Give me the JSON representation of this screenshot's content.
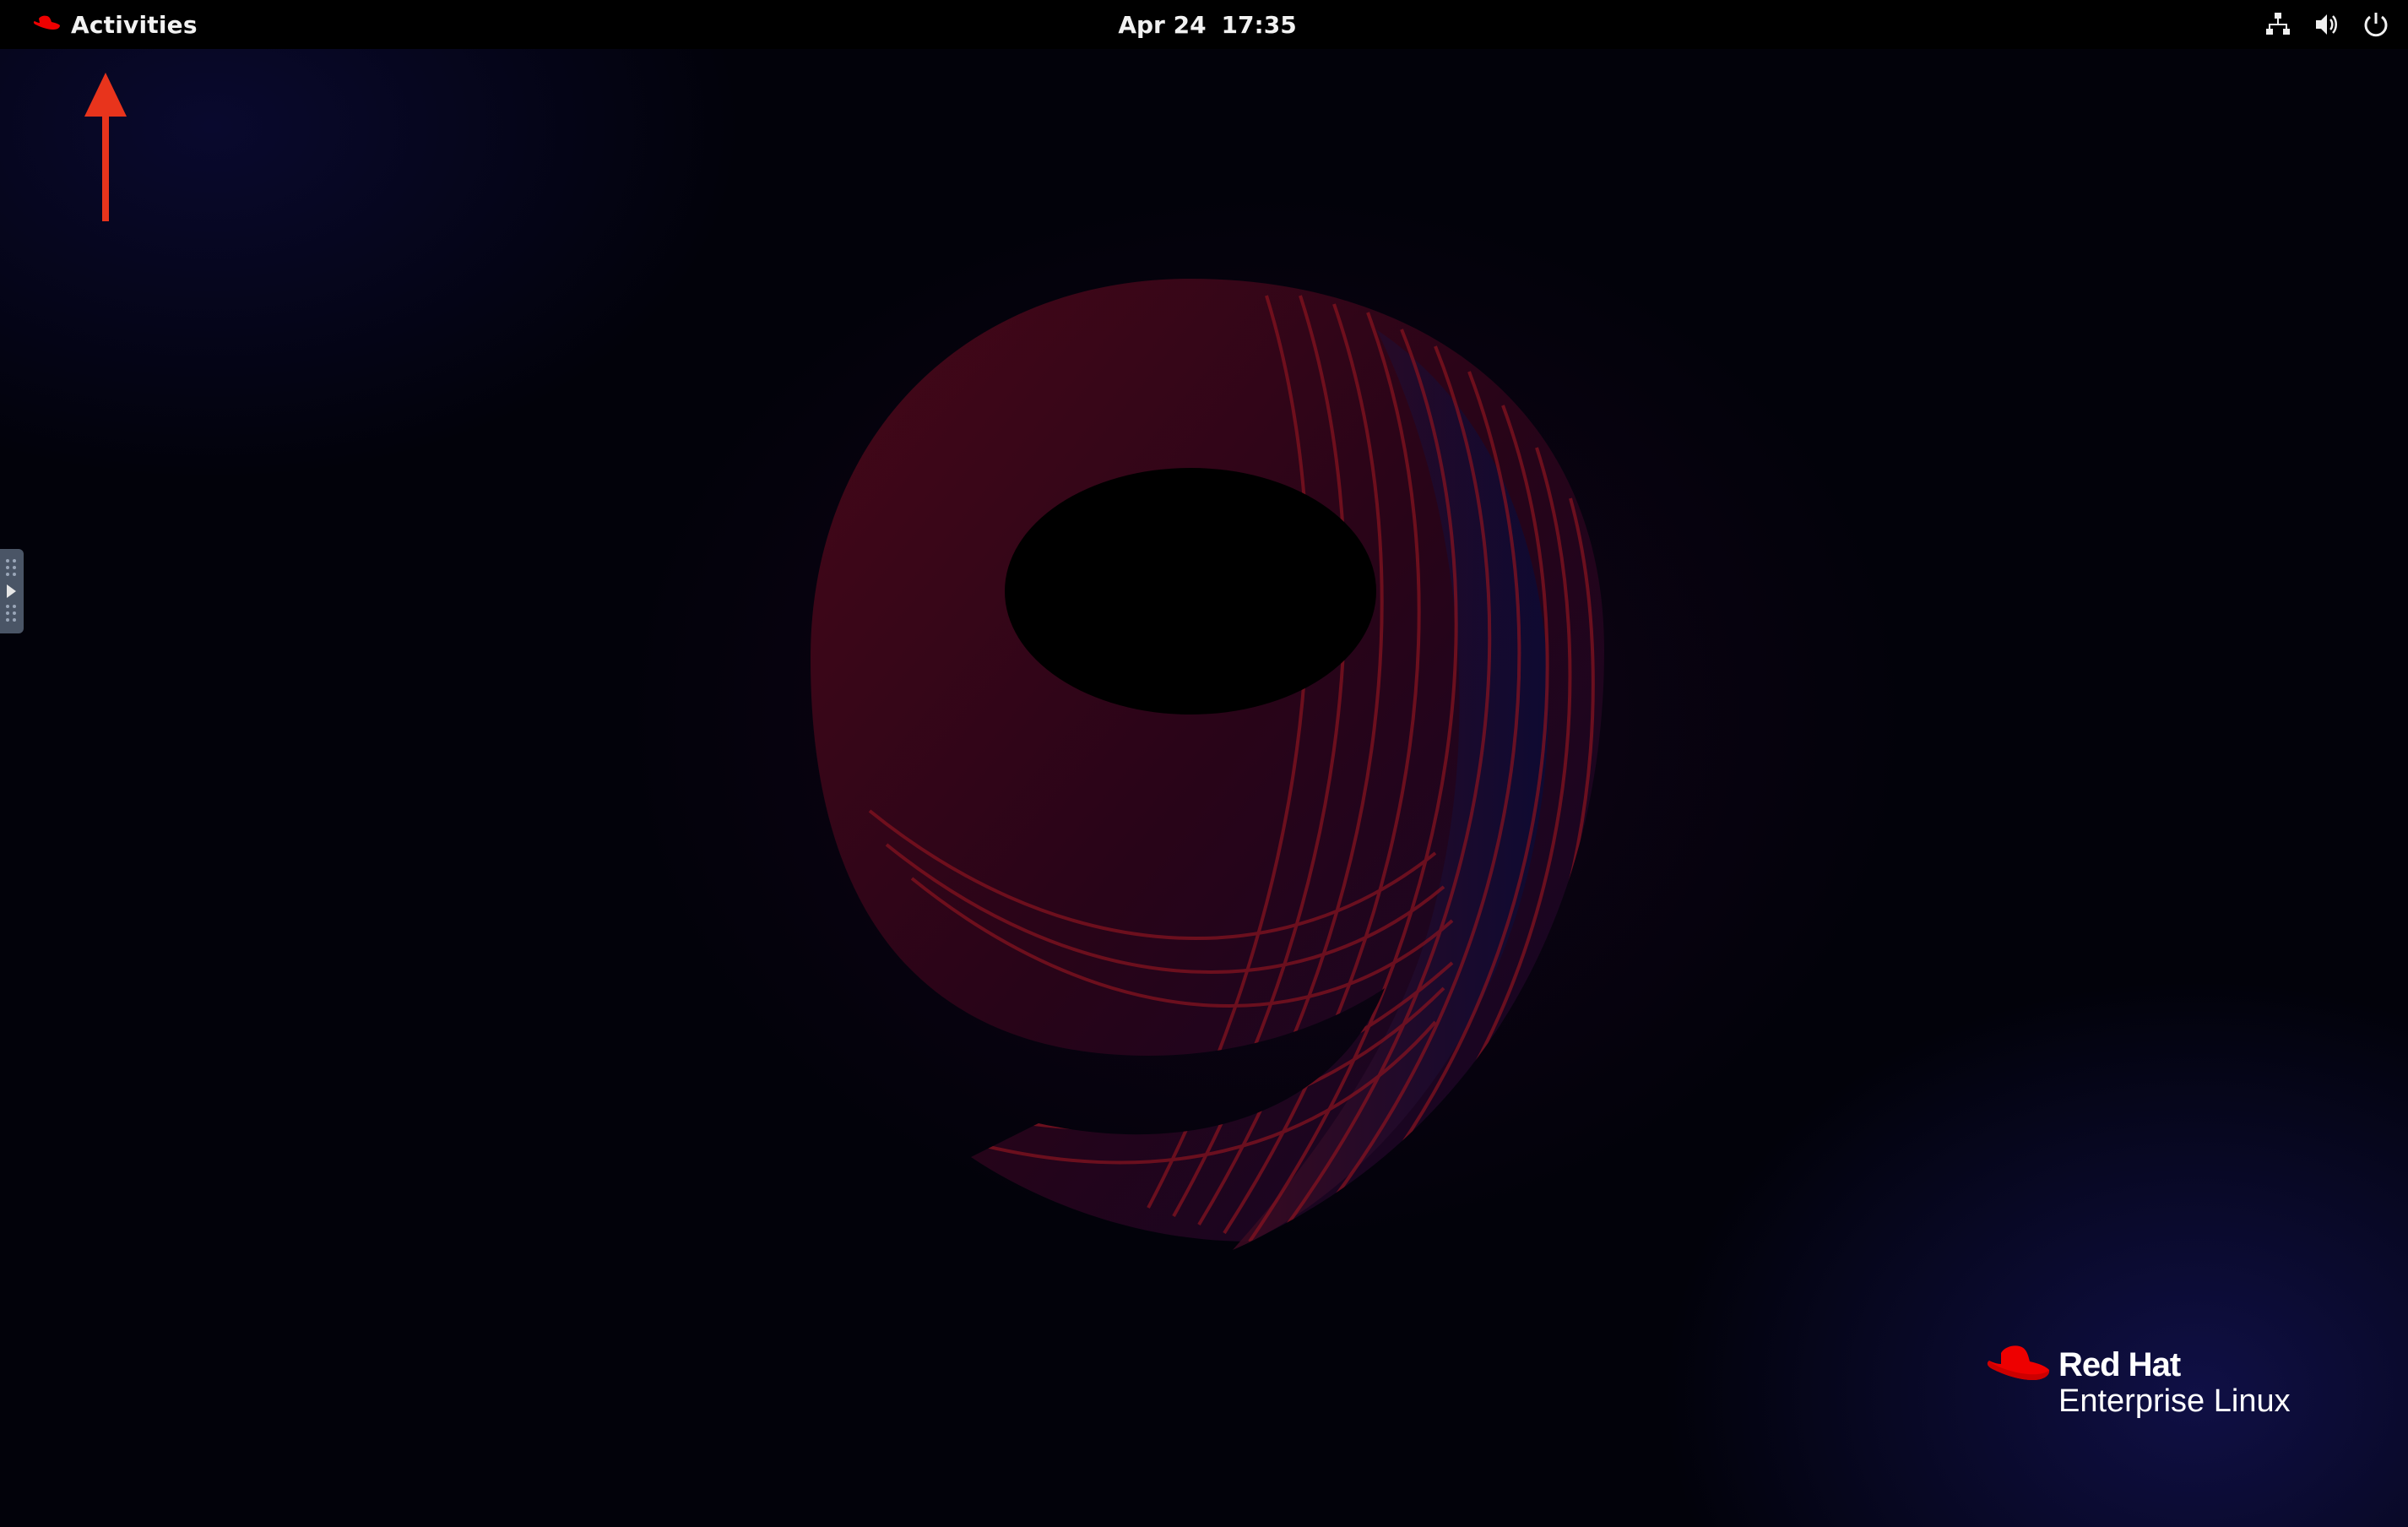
{
  "top_bar": {
    "activities_label": "Activities",
    "clock": {
      "date": "Apr 24",
      "time": "17:35"
    },
    "status_icons": [
      "network-wired-icon",
      "volume-icon",
      "power-icon"
    ]
  },
  "desktop": {
    "wallpaper_glyph": "9",
    "logo": {
      "brand": "Red Hat",
      "product": "Enterprise Linux"
    }
  },
  "colors": {
    "top_bar": "#000000",
    "accent_red": "#ee0000",
    "annotation_arrow": "#e8341c",
    "side_handle": "#4a5566"
  }
}
